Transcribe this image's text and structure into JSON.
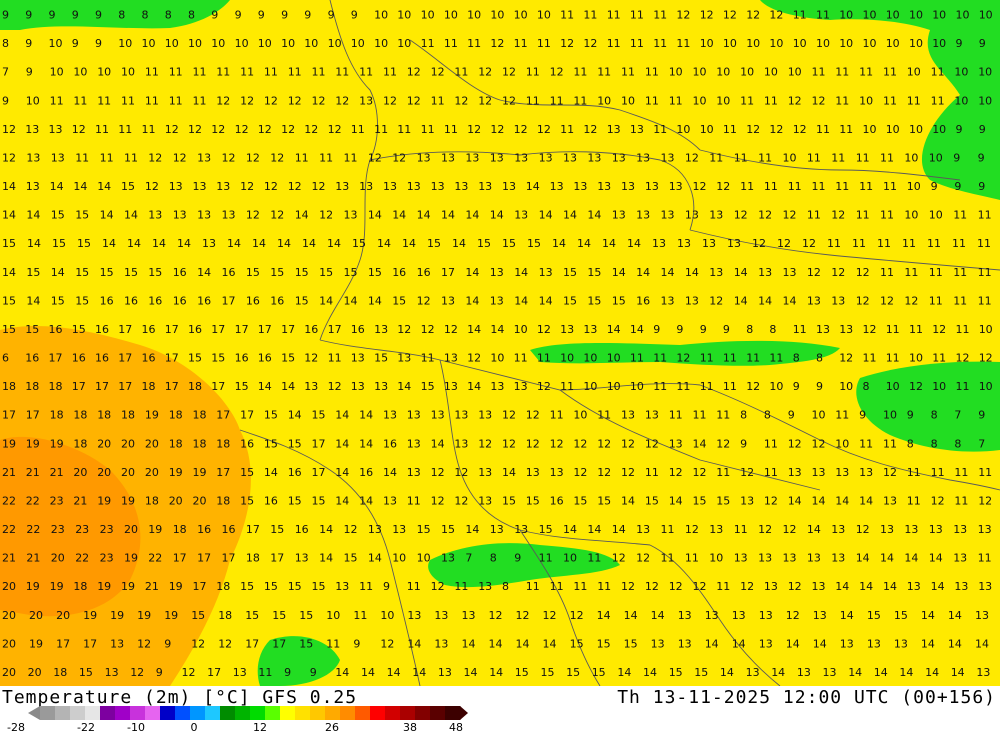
{
  "map": {
    "title_left": "Temperature (2m) [°C] GFS 0.25",
    "title_right": "Th 13-11-2025 12:00 UTC (00+156)",
    "colorbar": {
      "ticks": [
        "-28",
        "-22",
        "-10",
        "0",
        "12",
        "26",
        "38",
        "48"
      ],
      "colors": [
        "#9a9a9a",
        "#b4b4b4",
        "#cdcdcd",
        "#e6e6e6",
        "#7d00a0",
        "#a000c8",
        "#c832dc",
        "#e664f0",
        "#0000c8",
        "#0050ff",
        "#0096ff",
        "#1ec8ff",
        "#008c00",
        "#00b400",
        "#00dc00",
        "#5aff00",
        "#ffff00",
        "#ffe100",
        "#ffc800",
        "#ffaa00",
        "#ff8c00",
        "#ff5a00",
        "#ff0000",
        "#d20000",
        "#aa0000",
        "#820000",
        "#5a0000",
        "#3c0000"
      ]
    },
    "colors": {
      "yellow": "#ffea00",
      "orange": "#ffb300",
      "dark_orange": "#ff9900",
      "green": "#22dd22",
      "border": "#5a5a5a"
    },
    "grid_values": [
      "9 9 9 9 9 8 8 8 8 9 9 9 9 9 9 9 10 10 10 10 10 10 10 10 11 11 11 11 11 12 12 12 12 12 11 11 10 10 10 10 10 10 10",
      "8 9 10 9 9 10 10 10 10 10 10 10 10 10 10 10 10 10 11 11 11 12 11 11 12 12 11 11 11 11 10 10 10 10 10 10 10 10 10 10 10 9 9",
      "7 9 10 10 10 10 11 11 11 11 11 11 11 11 11 11 11 12 12 11 12 12 11 12 11 11 11 11 10 10 10 10 10 10 11 11 11 11 10 11 10 10",
      "9 10 11 11 11 11 11 11 11 12 12 12 12 12 12 13 12 12 11 12 12 12 11 11 11 10 10 11 11 10 10 11 11 12 12 11 10 11 11 11 10 10",
      "12 13 13 12 11 11 11 12 12 12 12 12 12 12 12 11 11 11 11 11 12 12 12 12 11 12 13 13 11 10 10 11 12 12 12 11 11 10 10 10 10 9 9",
      "12 13 13 11 11 11 12 12 13 12 12 12 11 11 11 12 12 13 13 13 13 13 13 13 13 13 13 13 12 11 11 11 10 11 11 11 11 10 10 9 9",
      "14 13 14 14 14 15 12 13 13 13 12 12 12 12 13 13 13 13 13 13 13 13 14 13 13 13 13 13 13 12 12 11 11 11 11 11 11 11 10 9 9 9",
      "14 14 15 15 14 14 13 13 13 13 12 12 14 12 13 14 14 14 14 14 14 13 14 14 14 13 13 13 13 13 12 12 12 11 12 11 11 10 10 11 11",
      "15 14 15 15 14 14 14 14 13 14 14 14 14 14 15 14 14 15 14 15 15 15 14 14 14 14 13 13 13 13 12 12 12 11 11 11 11 11 11 11",
      "14 15 14 15 15 15 15 16 14 16 15 15 15 15 15 15 16 16 17 14 13 14 13 15 15 14 14 14 14 13 14 13 13 12 12 12 11 11 11 11 11",
      "15 14 15 15 16 16 16 16 16 17 16 16 15 14 14 14 15 12 13 14 13 14 14 15 15 15 16 13 13 12 14 14 14 13 13 12 12 12 11 11 11",
      "15 15 16 15 16 17 16 17 16 17 17 17 17 16 17 16 13 12 12 12 14 14 10 12 13 13 14 14 9 9 9 9 8 8 11 13 13 12 11 11 12 11 10",
      "6 16 17 16 16 17 16 17 15 15 16 16 15 12 11 13 15 13 11 13 12 10 11 11 10 10 10 11 11 12 11 11 11 11 8 8 12 11 11 10 11 12 12",
      "18 18 18 17 17 17 18 17 18 17 15 14 14 13 12 13 13 14 15 13 14 13 13 12 11 10 10 10 11 11 11 11 12 10 9 9 10 8 10 12 10 11 10",
      "17 17 18 18 18 18 19 18 18 17 17 15 14 15 14 14 13 13 13 13 13 12 12 11 10 11 13 13 11 11 11 8 8 9 10 11 9 10 9 8 7 9",
      "19 19 19 18 20 20 20 18 18 18 16 15 15 17 14 14 16 13 14 13 12 12 12 12 12 12 12 12 13 14 12 9 11 12 12 10 11 11 8 8 8 7",
      "21 21 21 20 20 20 20 19 19 17 15 14 16 17 14 16 14 13 12 12 13 14 13 13 12 12 12 11 12 12 11 12 11 13 13 13 13 12 11 11 11 11",
      "22 22 23 21 19 19 18 20 20 18 15 16 15 15 14 14 13 11 12 12 13 15 15 16 15 15 14 15 14 15 15 13 12 14 14 14 14 13 11 12 11 12",
      "22 22 23 23 23 20 19 18 16 16 17 15 16 14 12 13 13 15 15 14 13 13 15 14 14 14 13 11 12 13 11 12 12 14 13 12 13 13 13 13 13",
      "21 21 20 22 23 19 22 17 17 17 18 17 13 14 15 14 10 10 13 7 8 9 11 10 11 12 12 11 11 10 13 13 13 13 13 14 14 14 14 13 11",
      "20 19 19 18 19 19 21 19 17 18 15 15 15 15 13 11 9 11 12 11 13 8 11 11 11 11 12 12 12 12 11 12 13 12 13 14 14 14 13 14 13 13",
      "20 20 20 19 19 19 19 15 18 15 15 15 10 11 10 13 13 13 12 12 12 12 14 14 14 13 13 13 13 12 13 14 15 15 14 14 13",
      "20 19 17 17 13 12 9 12 12 17 17 15 11 9 12 14 13 14 14 14 14 15 15 15 13 13 14 14 13 14 14 13 13 13 14 14 14",
      "20 20 18 15 13 12 9 12 17 13 11 9 9 14 14 14 14 13 14 14 15 15 15 15 14 14 15 15 14 13 14 13 13 14 14 14 14 14 13"
    ]
  }
}
